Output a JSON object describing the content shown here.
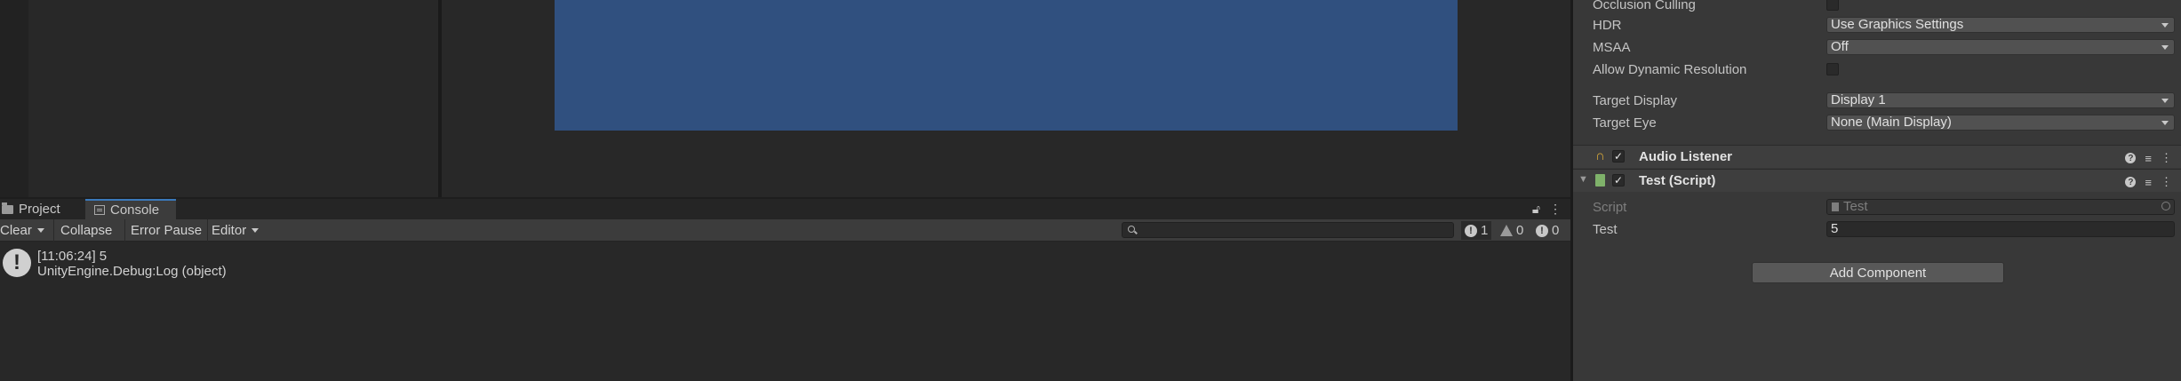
{
  "tabs": [
    {
      "label": "Project",
      "icon": "folder-icon"
    },
    {
      "label": "Console",
      "icon": "console-icon"
    }
  ],
  "tab_tools": {
    "lock_icon": "lock-icon",
    "menu_icon": "kebab-menu-icon"
  },
  "console_toolbar": {
    "clear": "Clear",
    "collapse": "Collapse",
    "error_pause": "Error Pause",
    "editor": "Editor",
    "search_placeholder": "",
    "counts": {
      "log": "1",
      "warning": "0",
      "error": "0"
    }
  },
  "console_log": [
    {
      "line1": "[11:06:24] 5",
      "line2": "UnityEngine.Debug:Log (object)"
    }
  ],
  "inspector": {
    "camera_props": [
      {
        "label": "Occlusion Culling",
        "type": "checkbox"
      },
      {
        "label": "HDR",
        "type": "dropdown",
        "value": "Use Graphics Settings"
      },
      {
        "label": "MSAA",
        "type": "dropdown",
        "value": "Off"
      },
      {
        "label": "Allow Dynamic Resolution",
        "type": "checkbox"
      },
      {
        "label": "Target Display",
        "type": "dropdown",
        "value": "Display 1"
      },
      {
        "label": "Target Eye",
        "type": "dropdown",
        "value": "None (Main Display)"
      }
    ],
    "audio_listener": {
      "title": "Audio Listener",
      "enabled": true
    },
    "test_script": {
      "title": "Test (Script)",
      "script_label": "Script",
      "script_value": "Test",
      "field_label": "Test",
      "field_value": "5"
    },
    "add_component": "Add Component"
  },
  "colors": {
    "game_view": "#30507f",
    "active_tab_accent": "#3a79bb"
  }
}
